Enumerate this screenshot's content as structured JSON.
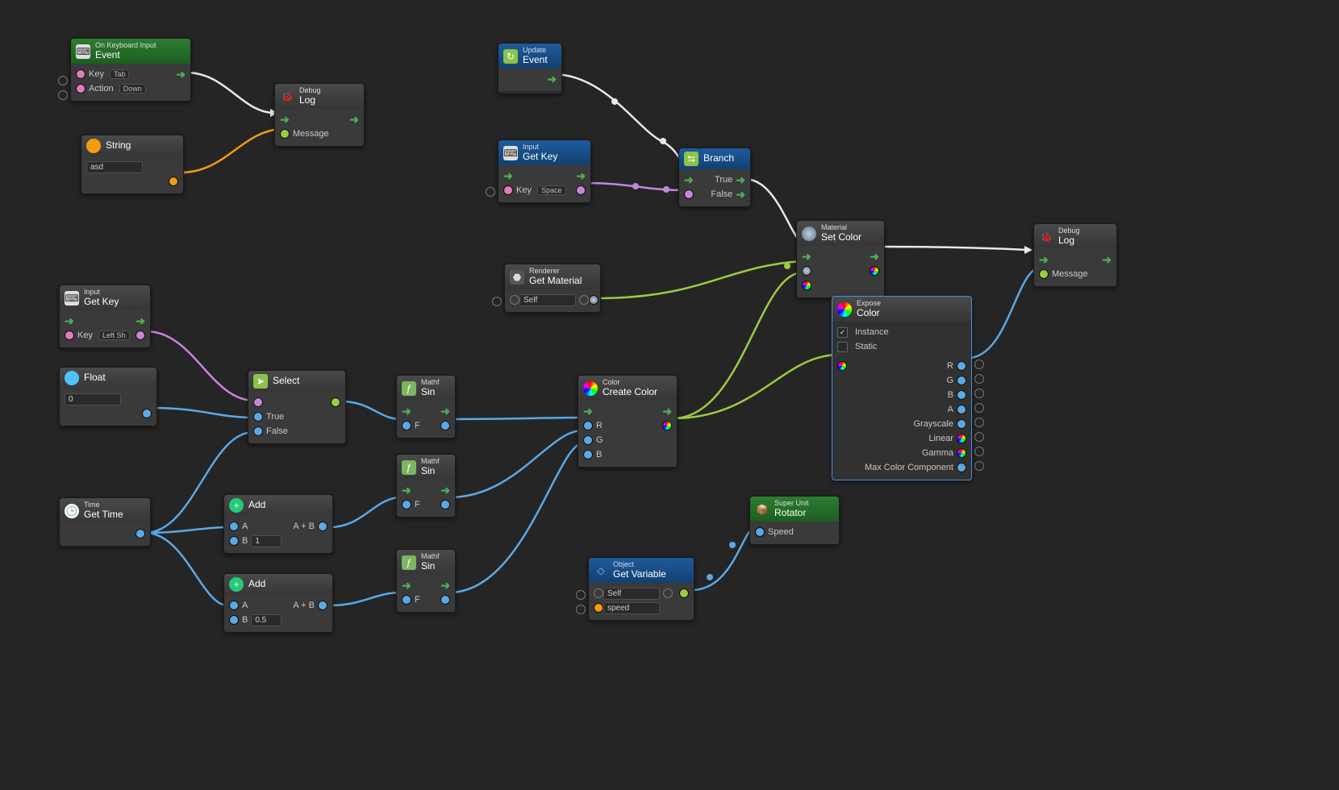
{
  "nodes": {
    "kbInput": {
      "sup": "On Keyboard Input",
      "ttl": "Event",
      "p1": "Key",
      "p1v": "Tab",
      "p2": "Action",
      "p2v": "Down"
    },
    "debug1": {
      "sup": "Debug",
      "ttl": "Log",
      "p1": "Message"
    },
    "string": {
      "ttl": "String",
      "val": "asd"
    },
    "update": {
      "sup": "Update",
      "ttl": "Event"
    },
    "getkey1": {
      "sup": "Input",
      "ttl": "Get Key",
      "p1": "Key",
      "p1v": "Space"
    },
    "branch": {
      "ttl": "Branch",
      "p1": "True",
      "p2": "False"
    },
    "setcolor": {
      "sup": "Material",
      "ttl": "Set Color"
    },
    "debug2": {
      "sup": "Debug",
      "ttl": "Log",
      "p1": "Message"
    },
    "getmat": {
      "sup": "Renderer",
      "ttl": "Get Material",
      "p1": "Self"
    },
    "getkey2": {
      "sup": "Input",
      "ttl": "Get Key",
      "p1": "Key",
      "p1v": "Left Sh"
    },
    "float": {
      "ttl": "Float",
      "val": "0"
    },
    "select": {
      "ttl": "Select",
      "p1": "True",
      "p2": "False"
    },
    "sin1": {
      "sup": "Mathf",
      "ttl": "Sin",
      "p1": "F"
    },
    "color": {
      "sup": "Color",
      "ttl": "Create Color",
      "p1": "R",
      "p2": "G",
      "p3": "B"
    },
    "expose": {
      "sup": "Expose",
      "ttl": "Color",
      "c1": "Instance",
      "c2": "Static",
      "o1": "R",
      "o2": "G",
      "o3": "B",
      "o4": "A",
      "o5": "Grayscale",
      "o6": "Linear",
      "o7": "Gamma",
      "o8": "Max Color Component"
    },
    "time": {
      "sup": "Time",
      "ttl": "Get Time"
    },
    "add1": {
      "ttl": "Add",
      "pa": "A",
      "pb": "B",
      "pbv": "1",
      "out": "A + B"
    },
    "add2": {
      "ttl": "Add",
      "pa": "A",
      "pb": "B",
      "pbv": "0.5",
      "out": "A + B"
    },
    "sin2": {
      "sup": "Mathf",
      "ttl": "Sin",
      "p1": "F"
    },
    "sin3": {
      "sup": "Mathf",
      "ttl": "Sin",
      "p1": "F"
    },
    "getvar": {
      "sup": "Object",
      "ttl": "Get Variable",
      "p1": "Self",
      "p2": "speed"
    },
    "rotator": {
      "sup": "Super Unit",
      "ttl": "Rotator",
      "p1": "Speed"
    }
  }
}
